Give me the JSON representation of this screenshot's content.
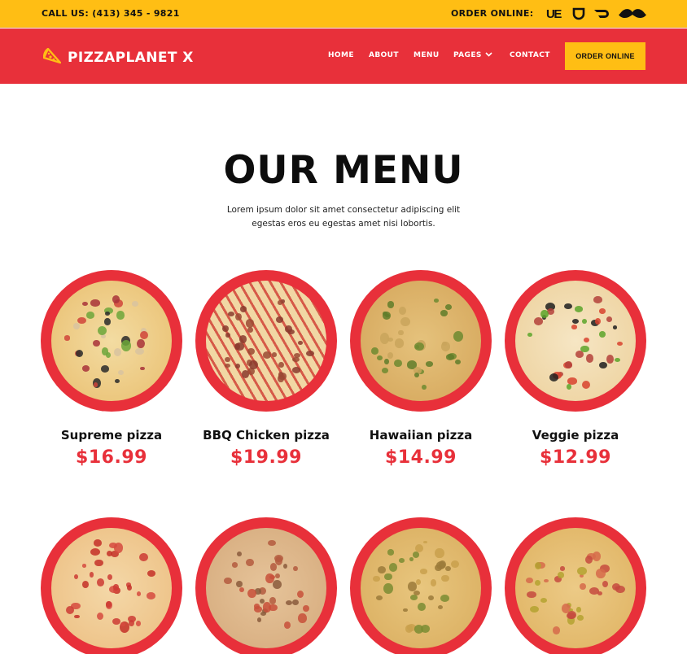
{
  "topbar": {
    "call_us": "CALL US: (413) 345 - 9821",
    "order_online_label": "ORDER ONLINE:",
    "delivery_services": [
      {
        "name": "uber-eats",
        "text": "UE"
      },
      {
        "name": "grubhub",
        "text": ""
      },
      {
        "name": "doordash",
        "text": ""
      },
      {
        "name": "postmates",
        "text": ""
      }
    ]
  },
  "navbar": {
    "brand": "PIZZAPLANET X",
    "links": [
      "HOME",
      "ABOUT",
      "MENU",
      "PAGES",
      "CONTACT"
    ],
    "cta": "ORDER ONLINE"
  },
  "colors": {
    "primary_red": "#e8303a",
    "accent_yellow": "#ffbe14",
    "text_dark": "#111111"
  },
  "hero": {
    "title": "OUR MENU",
    "subtitle": "Lorem ipsum dolor sit amet consectetur adipiscing elit egestas eros eu egestas amet nisi lobortis."
  },
  "menu": {
    "items": [
      {
        "name": "Supreme pizza",
        "price": "$16.99",
        "style": "supreme"
      },
      {
        "name": "BBQ Chicken pizza",
        "price": "$19.99",
        "style": "bbq"
      },
      {
        "name": "Hawaiian pizza",
        "price": "$14.99",
        "style": "hawaiian"
      },
      {
        "name": "Veggie pizza",
        "price": "$12.99",
        "style": "veggie"
      },
      {
        "name": "",
        "price": "",
        "style": "pepperoni"
      },
      {
        "name": "",
        "price": "",
        "style": "meat"
      },
      {
        "name": "",
        "price": "",
        "style": "cheese"
      },
      {
        "name": "",
        "price": "",
        "style": "mixed"
      }
    ]
  }
}
